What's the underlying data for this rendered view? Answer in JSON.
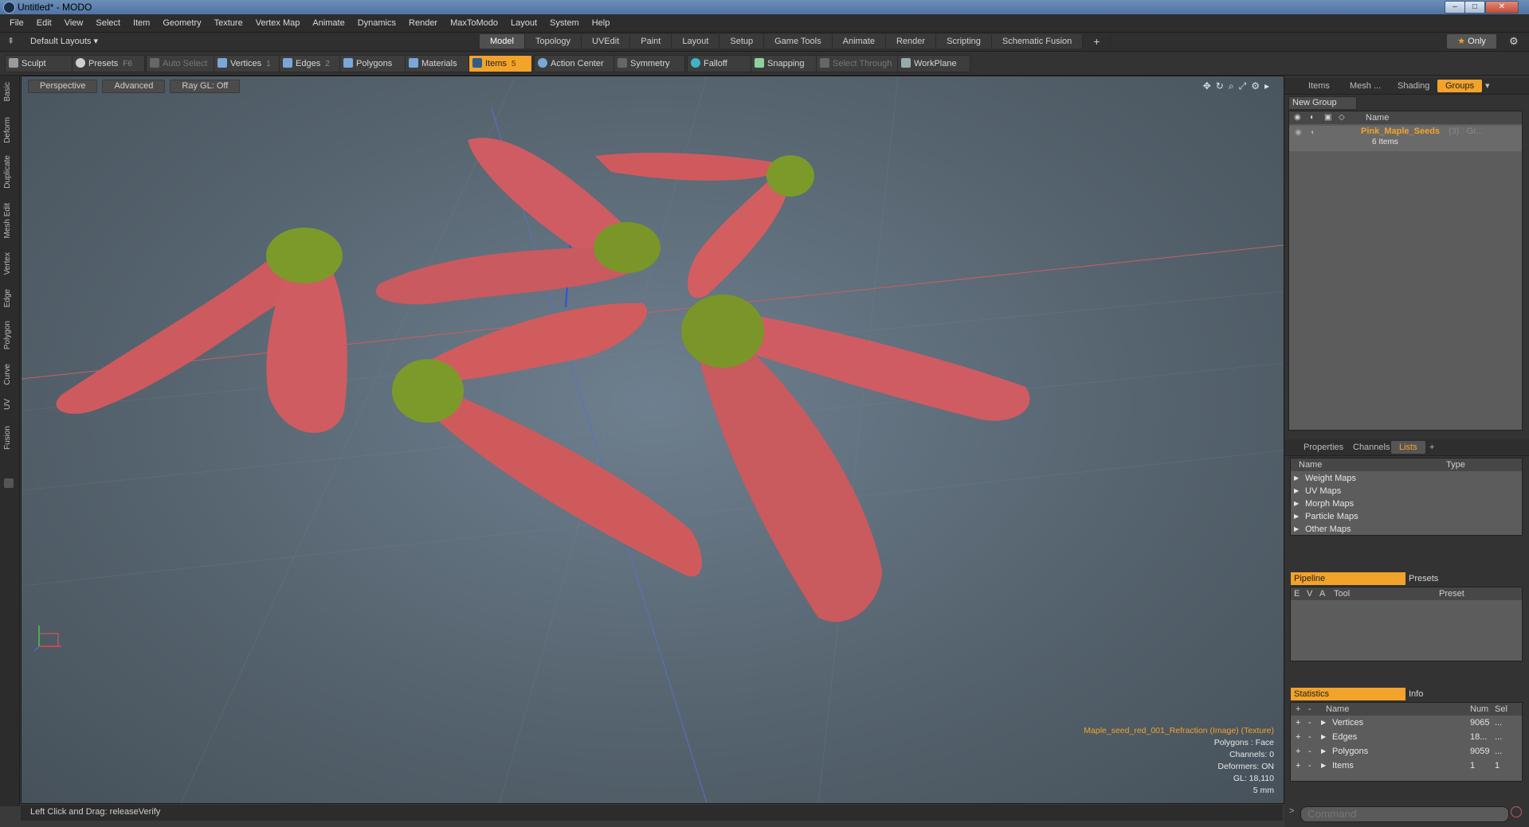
{
  "window": {
    "title": "Untitled* - MODO"
  },
  "menu": [
    "File",
    "Edit",
    "View",
    "Select",
    "Item",
    "Geometry",
    "Texture",
    "Vertex Map",
    "Animate",
    "Dynamics",
    "Render",
    "MaxToModo",
    "Layout",
    "System",
    "Help"
  ],
  "layout": {
    "selector": "Default Layouts ▾",
    "tabs": [
      "Model",
      "Topology",
      "UVEdit",
      "Paint",
      "Layout",
      "Setup",
      "Game Tools",
      "Animate",
      "Render",
      "Scripting",
      "Schematic Fusion"
    ],
    "active_tab": "Model",
    "add": "+",
    "only": "Only"
  },
  "toolbar": {
    "sculpt": "Sculpt",
    "presets": "Presets",
    "presets_key": "F6",
    "auto_select": "Auto Select",
    "vertices": "Vertices",
    "vertices_key": "1",
    "edges": "Edges",
    "edges_key": "2",
    "polygons": "Polygons",
    "materials": "Materials",
    "items": "Items",
    "items_key": "5",
    "action_center": "Action Center",
    "symmetry": "Symmetry",
    "falloff": "Falloff",
    "snapping": "Snapping",
    "select_through": "Select Through",
    "workplane": "WorkPlane"
  },
  "left_tabs": [
    "Basic",
    "Deform",
    "Duplicate",
    "Mesh Edit",
    "Vertex",
    "Edge",
    "Polygon",
    "Curve",
    "UV",
    "Fusion"
  ],
  "viewport": {
    "view": "Perspective",
    "shading": "Advanced",
    "raygl": "Ray GL: Off",
    "hud": {
      "texture": "Maple_seed_red_001_Refraction (Image) (Texture)",
      "polygons": "Polygons : Face",
      "channels": "Channels: 0",
      "deformers": "Deformers: ON",
      "gl": "GL: 18,110",
      "scale": "5 mm"
    }
  },
  "status": {
    "text": "Left Click and Drag:   releaseVerify"
  },
  "groups_panel": {
    "tabs": [
      "Items",
      "Mesh ...",
      "Shading",
      "Groups"
    ],
    "active_tab": "Groups",
    "new_group": "New Group",
    "col_name": "Name",
    "group_name": "Pink_Maple_Seeds",
    "group_suffix": "(3) : Gr...",
    "group_count": "6 Items"
  },
  "lists_panel": {
    "tabs": [
      "Properties",
      "Channels",
      "Lists"
    ],
    "active_tab": "Lists",
    "add": "+",
    "col_name": "Name",
    "col_type": "Type",
    "items": [
      "Weight Maps",
      "UV Maps",
      "Morph Maps",
      "Particle Maps",
      "Other Maps"
    ]
  },
  "pipeline_panel": {
    "tabs": [
      "Pipeline",
      "Presets"
    ],
    "cols": [
      "E",
      "V",
      "A",
      "Tool",
      "Preset"
    ]
  },
  "stats_panel": {
    "tabs": [
      "Statistics",
      "Info"
    ],
    "col_name": "Name",
    "col_num": "Num",
    "col_sel": "Sel",
    "rows": [
      {
        "name": "Vertices",
        "num": "9065",
        "sel": "..."
      },
      {
        "name": "Edges",
        "num": "18...",
        "sel": "..."
      },
      {
        "name": "Polygons",
        "num": "9059",
        "sel": "..."
      },
      {
        "name": "Items",
        "num": "1",
        "sel": "1"
      }
    ]
  },
  "command": {
    "placeholder": "Command"
  },
  "colors": {
    "accent": "#f2a32a",
    "wing": "#cf5a5a",
    "seed": "#7c9a2a"
  }
}
